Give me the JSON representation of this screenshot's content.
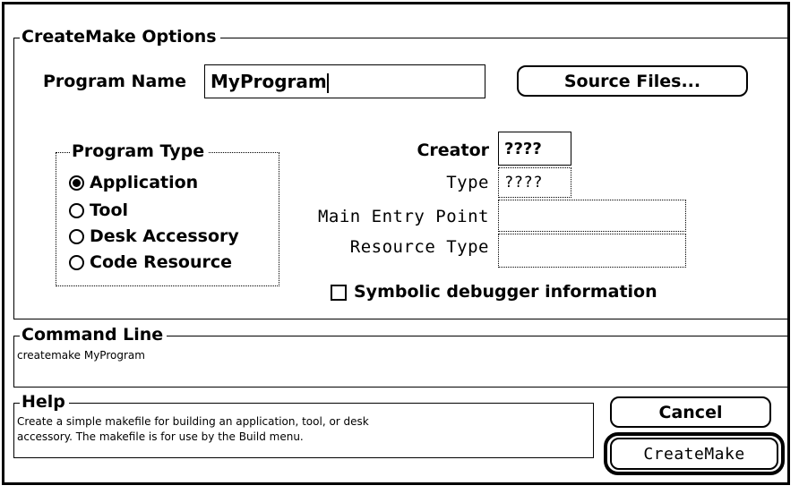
{
  "options_group": {
    "legend": "CreateMake Options",
    "program_name_label": "Program Name",
    "program_name_value": "MyProgram",
    "source_files_button": "Source Files..."
  },
  "program_type": {
    "legend": "Program Type",
    "options": [
      "Application",
      "Tool",
      "Desk Accessory",
      "Code Resource"
    ],
    "selected": "Application"
  },
  "fields": {
    "creator_label": "Creator",
    "creator_value": "????",
    "type_label": "Type",
    "type_value": "????",
    "main_entry_label": "Main Entry Point",
    "main_entry_value": "",
    "resource_type_label": "Resource Type",
    "resource_type_value": ""
  },
  "symbolic_debugger": {
    "label": "Symbolic debugger information",
    "checked": false
  },
  "command_line": {
    "legend": "Command Line",
    "text": "createmake MyProgram"
  },
  "help": {
    "legend": "Help",
    "text_line1": "Create a simple makefile for building an application, tool, or desk",
    "text_line2": "accessory. The makefile is for use by the Build menu."
  },
  "buttons": {
    "cancel": "Cancel",
    "createmake": "CreateMake"
  }
}
